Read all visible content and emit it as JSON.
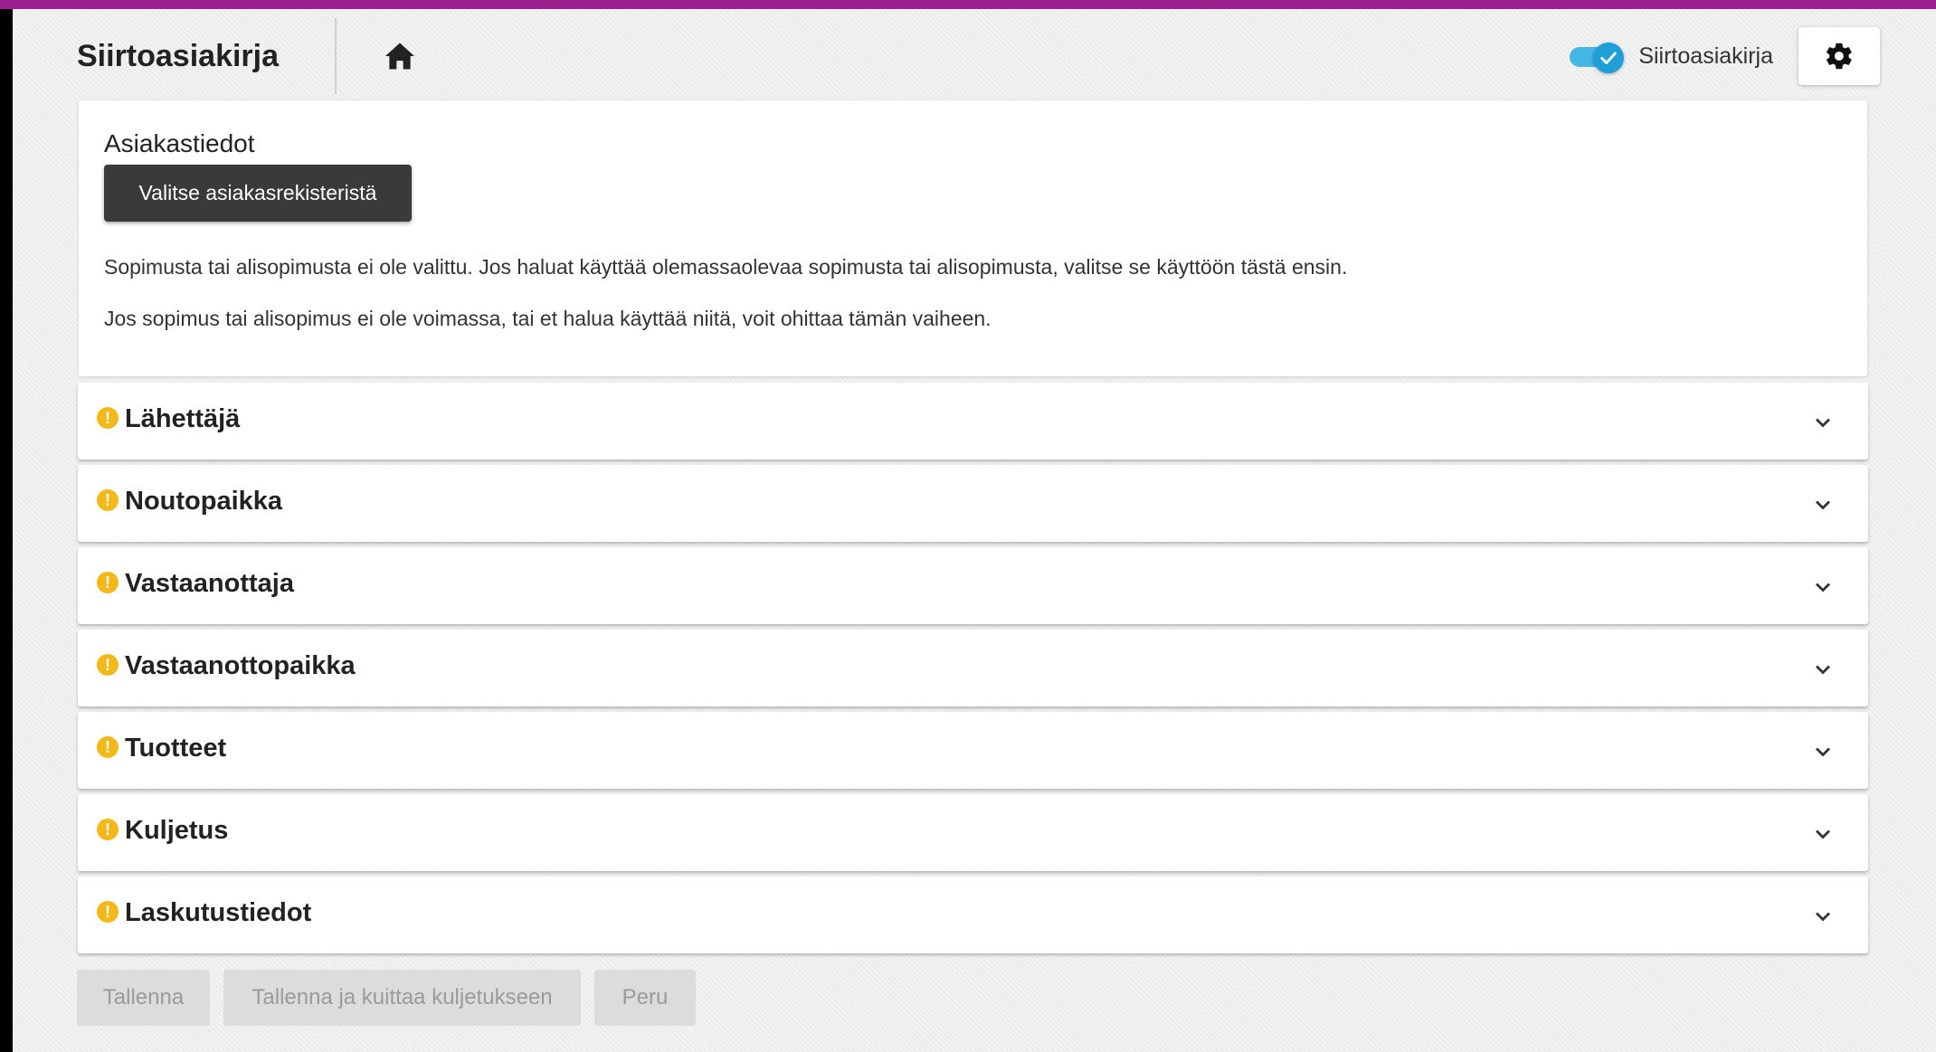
{
  "header": {
    "title": "Siirtoasiakirja",
    "home_icon": "home-icon",
    "toggle_label": "Siirtoasiakirja",
    "toggle_on": true,
    "settings_icon": "gear-icon"
  },
  "customer": {
    "heading": "Asiakastiedot",
    "select_button": "Valitse asiakasrekisteristä",
    "text1": "Sopimusta tai alisopimusta ei ole valittu. Jos haluat käyttää olemassaolevaa sopimusta tai alisopimusta, valitse se käyttöön tästä ensin.",
    "text2": "Jos sopimus tai alisopimus ei ole voimassa, tai et halua käyttää niitä, voit ohittaa tämän vaiheen."
  },
  "sections": [
    {
      "label": "Lähettäjä"
    },
    {
      "label": "Noutopaikka"
    },
    {
      "label": "Vastaanottaja"
    },
    {
      "label": "Vastaanottopaikka"
    },
    {
      "label": "Tuotteet"
    },
    {
      "label": "Kuljetus"
    },
    {
      "label": "Laskutustiedot"
    }
  ],
  "footer": {
    "save": "Tallenna",
    "save_and_ack": "Tallenna ja kuittaa kuljetukseen",
    "cancel": "Peru"
  },
  "colors": {
    "accent": "#1e9fd8",
    "warning": "#f3b81a",
    "primary_button": "#3a3a3a",
    "disabled_button": "#dcdcdc"
  }
}
